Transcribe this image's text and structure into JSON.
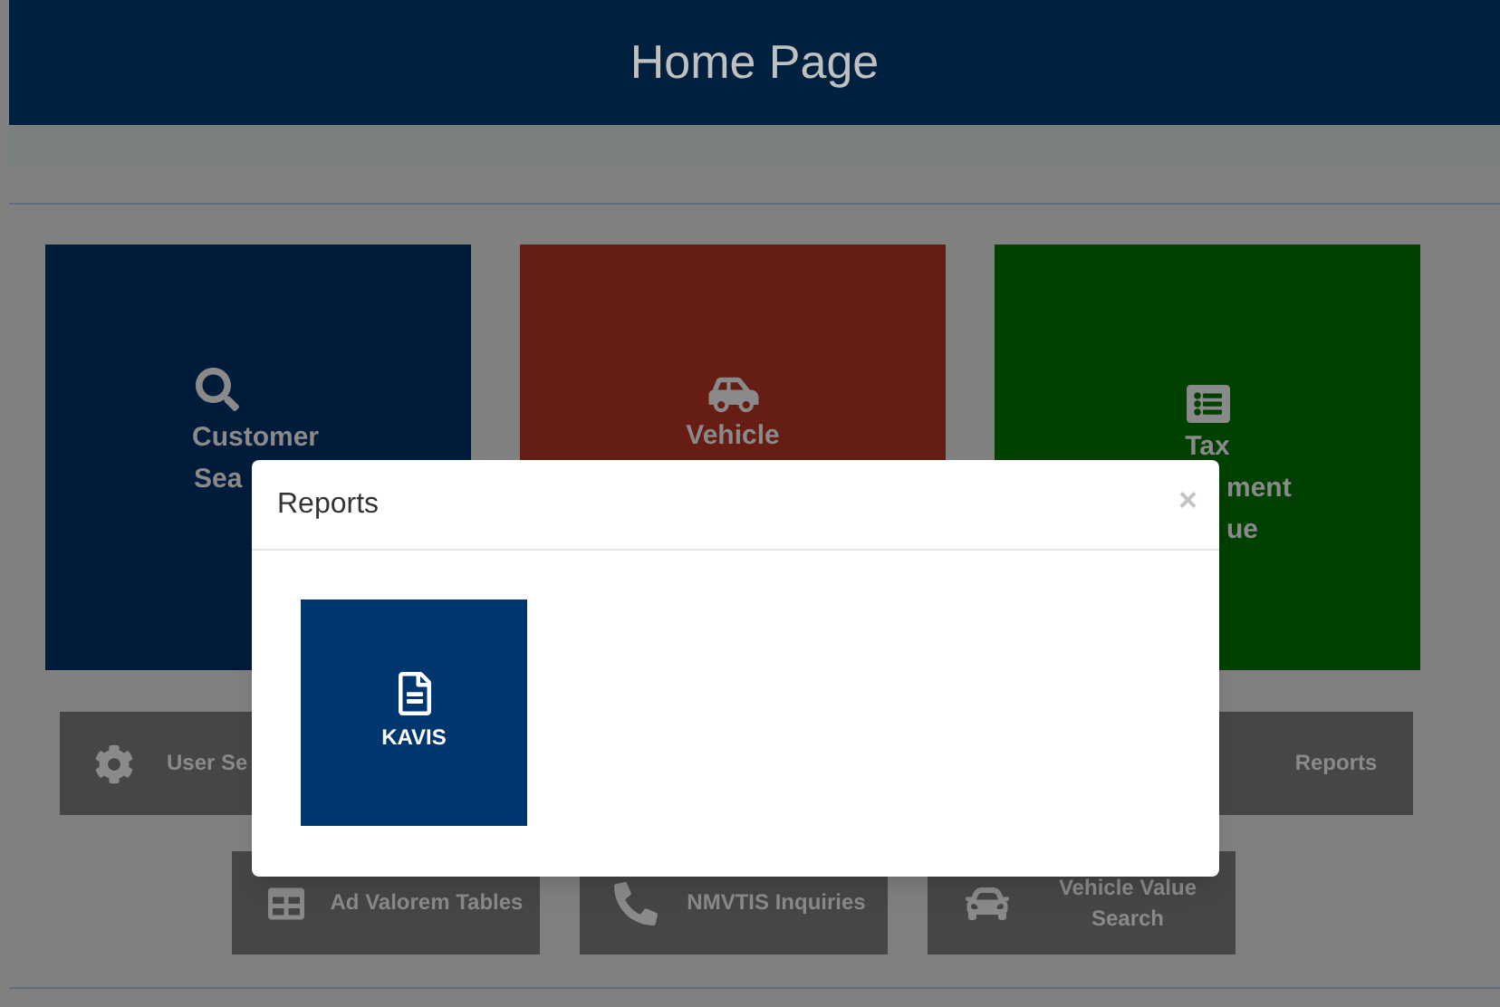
{
  "header": {
    "title": "Home Page"
  },
  "tiles": [
    {
      "kind": "search",
      "lines": [
        "Customer",
        "Sea"
      ]
    },
    {
      "kind": "vehicle",
      "lines": [
        "Vehicle"
      ]
    },
    {
      "kind": "tax",
      "lines": [
        "Tax",
        "ment",
        "ue"
      ]
    }
  ],
  "buttons_row_1": [
    {
      "kind": "settings",
      "label": "User Se"
    },
    {
      "kind": "hidden-icon",
      "label": "Reports"
    }
  ],
  "buttons_row_2": [
    {
      "kind": "table",
      "label": "Ad Valorem Tables"
    },
    {
      "kind": "phone",
      "label": "NMVTIS Inquiries"
    },
    {
      "kind": "car",
      "label": "Vehicle Value Search"
    }
  ],
  "modal": {
    "title": "Reports",
    "close": "×",
    "tiles": [
      {
        "kind": "document",
        "label": "KAVIS"
      }
    ]
  }
}
